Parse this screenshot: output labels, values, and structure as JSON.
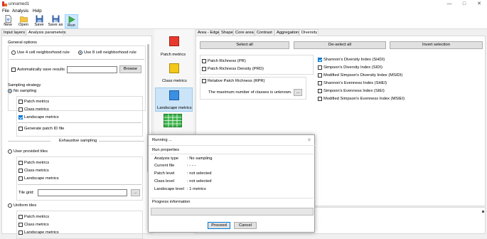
{
  "window": {
    "title": "unnamed1",
    "minimize": "—",
    "maximize": "□",
    "close": "✕"
  },
  "menu": [
    "File",
    "Analysis",
    "Help"
  ],
  "toolbar": {
    "new": "New",
    "open": "Open",
    "save": "Save",
    "save_as": "Save as",
    "run": "Run"
  },
  "left_tabs": [
    "Input layers",
    "Analysis parameters"
  ],
  "general": {
    "title": "General options",
    "rule4": "Use 4 cell neighborhood rule",
    "rule8": "Use 8 cell neighborhood rule",
    "autosave": "Automatically save results",
    "browse": "Browse"
  },
  "sampling": {
    "title": "Sampling strategy",
    "no_sampling": "No sampling",
    "patch": "Patch metrics",
    "class": "Class metrics",
    "landscape": "Landscape metrics",
    "patch_id": "Generate patch ID file",
    "exhaustive": "Exhaustive sampling",
    "user_tiles": "User provided tiles",
    "tile_grid": "Tile grid:",
    "ellipsis": "...",
    "uniform_tiles": "Uniform tiles"
  },
  "metric_types": [
    "Patch metrics",
    "Class metrics",
    "Landscape metrics"
  ],
  "metric_tabs": [
    "Area - Edge",
    "Shape",
    "Core area",
    "Contrast",
    "Aggregation",
    "Diversity"
  ],
  "diversity": {
    "select_all": "Select all",
    "deselect_all": "De-select all",
    "invert": "Invert selection",
    "left_items": [
      "Patch Richness  (PR)",
      "Patch Richness Density  (PRD)"
    ],
    "relative": "Relative Patch Richness  (RPR)",
    "unknown": "The maximum number of classes is unknown.",
    "ellipsis": "...",
    "right_items": [
      "Shannon's Diversity Index  (SHDI)",
      "Simpson's Diversity Index  (SIDI)",
      "Modified Simpson's Diversity Index  (MSIDI)",
      "Shannon's Evenness Index  (SHEI)",
      "Simpson's Evenness Index  (SIEI)",
      "Modified Simpson's Evenness Index  (MSIEI)"
    ]
  },
  "dialog": {
    "title": "Running ...",
    "close": "✕",
    "run_props": "Run properties",
    "rows": [
      {
        "k": "Analysis type",
        "v": ": No sampling"
      },
      {
        "k": "Current file",
        "v": ":  - - -"
      },
      {
        "k": "Patch level",
        "v": ": not selected"
      },
      {
        "k": "Class level",
        "v": ": not selected"
      },
      {
        "k": "Landscape level",
        "v": ": 1 metrics"
      }
    ],
    "progress_info": "Progress information",
    "proceed": "Proceed",
    "cancel": "Cancel"
  },
  "colors": {
    "accent": "#0078d7",
    "patch": "#e8392d",
    "class": "#f2c81b",
    "landscape": "#3a8fe0",
    "table": "#3cb34a"
  }
}
